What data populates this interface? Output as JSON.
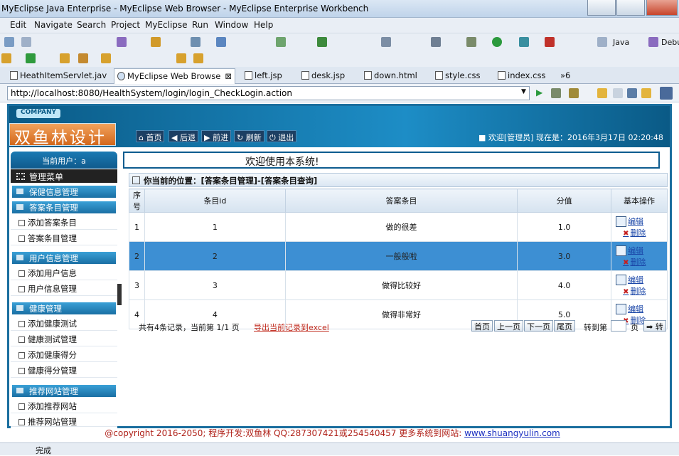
{
  "window": {
    "title": "MyEclipse Java Enterprise - MyEclipse Web Browser - MyEclipse Enterprise Workbench"
  },
  "menu": [
    "Edit",
    "Navigate",
    "Search",
    "Project",
    "MyEclipse",
    "Run",
    "Window",
    "Help"
  ],
  "perspectives": {
    "java": "Java",
    "debug": "Debu"
  },
  "tabs": [
    {
      "label": "HeathItemServlet.jav"
    },
    {
      "label": "MyEclipse Web Browse"
    },
    {
      "label": "left.jsp"
    },
    {
      "label": "desk.jsp"
    },
    {
      "label": "down.html"
    },
    {
      "label": "style.css"
    },
    {
      "label": "index.css"
    },
    {
      "label": "»6"
    }
  ],
  "url": "http://localhost:8080/HealthSystem/login/login_CheckLogin.action",
  "site": {
    "company": "COMPANY",
    "logo": "双鱼林设计",
    "nav": [
      "首页",
      "后退",
      "前进",
      "刷新",
      "退出"
    ],
    "welcome": "欢迎[管理员]  现在是：2016年3月17日  02:20:48",
    "welcome_bar": "欢迎使用本系统!"
  },
  "sidebar": {
    "current_user": "当前用户：a",
    "menu_title": "管理菜单",
    "sections": [
      {
        "title": "保健信息管理",
        "items": []
      },
      {
        "title": "答案条目管理",
        "items": [
          "添加答案条目",
          "答案条目管理"
        ]
      },
      {
        "title": "用户信息管理",
        "items": [
          "添加用户信息",
          "用户信息管理"
        ]
      },
      {
        "title": "健康管理",
        "items": [
          "添加健康测试",
          "健康测试管理",
          "添加健康得分",
          "健康得分管理"
        ]
      },
      {
        "title": "推荐网站管理",
        "items": [
          "添加推荐网站",
          "推荐网站管理"
        ]
      }
    ]
  },
  "location": "你当前的位置：[答案条目管理]-[答案条目查询]",
  "table": {
    "headers": [
      "序号",
      "条目id",
      "答案条目",
      "分值",
      "基本操作"
    ],
    "rows": [
      {
        "no": "1",
        "id": "1",
        "text": "做的很差",
        "score": "1.0"
      },
      {
        "no": "2",
        "id": "2",
        "text": "一般般啦",
        "score": "3.0"
      },
      {
        "no": "3",
        "id": "3",
        "text": "做得比较好",
        "score": "4.0"
      },
      {
        "no": "4",
        "id": "4",
        "text": "做得非常好",
        "score": "5.0"
      }
    ],
    "edit_label": "编辑",
    "delete_label": "删除",
    "selected_row": 2
  },
  "pager": {
    "info": "共有4条记录，当前第 1/1 页",
    "export": "导出当前记录到excel",
    "first": "首页",
    "prev": "上一页",
    "next": "下一页",
    "last": "尾页",
    "goto_prefix": "转到第",
    "goto_suffix": "页",
    "go": "转"
  },
  "footer": {
    "text": "@copyright 2016-2050; 程序开发:双鱼林  QQ:287307421或254540457  更多系统到网站:",
    "link": "www.shuangyulin.com"
  },
  "status": "完成"
}
